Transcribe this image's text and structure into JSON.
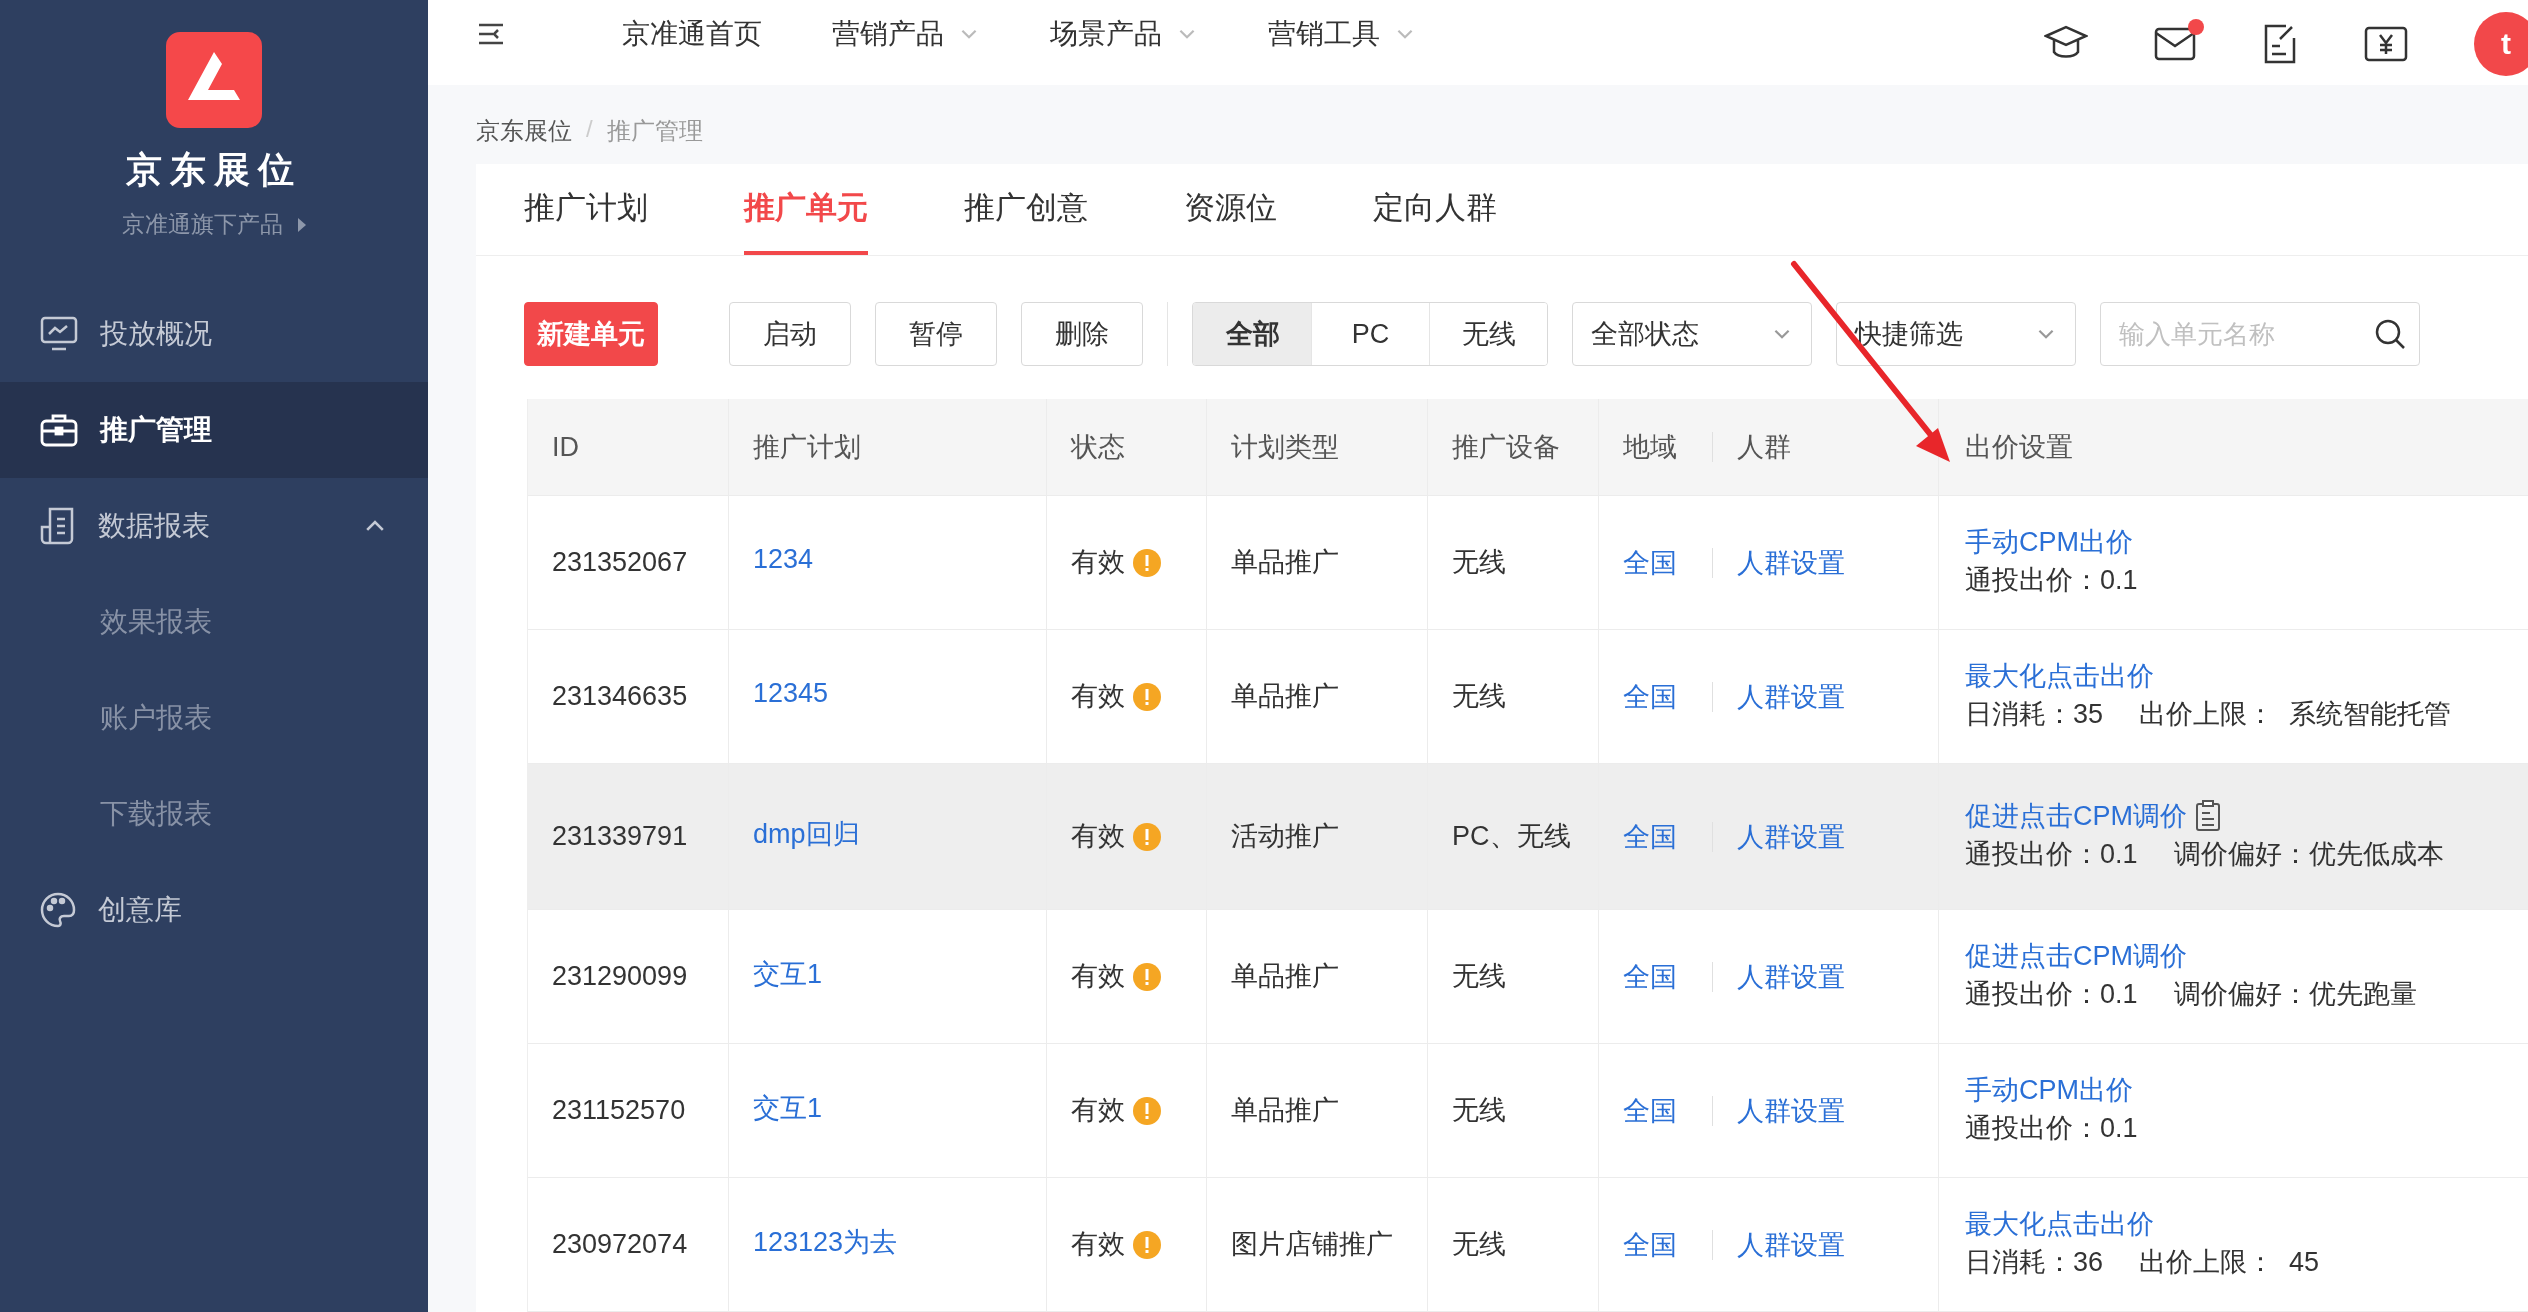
{
  "sidebar": {
    "brand": "京东展位",
    "subtitle": "京准通旗下产品",
    "items": [
      {
        "label": "投放概况",
        "selected": false
      },
      {
        "label": "推广管理",
        "selected": true
      },
      {
        "label": "数据报表",
        "selected": false,
        "expanded": true,
        "children": [
          {
            "label": "效果报表",
            "selected": false
          },
          {
            "label": "账户报表",
            "selected": false
          },
          {
            "label": "下载报表",
            "selected": false
          }
        ]
      },
      {
        "label": "创意库",
        "selected": false
      }
    ]
  },
  "top_nav": {
    "items": [
      {
        "label": "京准通首页",
        "dropdown": false
      },
      {
        "label": "营销产品",
        "dropdown": true
      },
      {
        "label": "场景产品",
        "dropdown": true
      },
      {
        "label": "营销工具",
        "dropdown": true
      }
    ],
    "mail_unread": true,
    "avatar": "t"
  },
  "breadcrumb": [
    "京东展位",
    "推广管理"
  ],
  "breadcrumb_separator": "/",
  "tabs": [
    {
      "label": "推广计划",
      "selected": false
    },
    {
      "label": "推广单元",
      "selected": true
    },
    {
      "label": "推广创意",
      "selected": false
    },
    {
      "label": "资源位",
      "selected": false
    },
    {
      "label": "定向人群",
      "selected": false
    }
  ],
  "toolbar": {
    "buttons": [
      {
        "label": "新建单元",
        "primary": true
      },
      {
        "label": "启动",
        "primary": false
      },
      {
        "label": "暂停",
        "primary": false
      },
      {
        "label": "删除",
        "primary": false
      }
    ],
    "segments": [
      {
        "label": "全部",
        "selected": true
      },
      {
        "label": "PC",
        "selected": false
      },
      {
        "label": "无线",
        "selected": false
      }
    ],
    "selects": [
      "全部状态",
      "快捷筛选"
    ],
    "search": {
      "placeholder": "输入单元名称"
    }
  },
  "table": {
    "columns": [
      "ID",
      "推广计划",
      "状态",
      "计划类型",
      "推广设备",
      "地域",
      "人群",
      "出价设置"
    ],
    "rows": [
      {
        "id": "231352067",
        "plan": "1234",
        "status": "有效",
        "warning": true,
        "plan_type": "单品推广",
        "device": "无线",
        "region": "全国",
        "crowd": "人群设置",
        "bid_title": "手动CPM出价",
        "bid_note_icon": false,
        "bid_details": [
          "通投出价：0.1"
        ],
        "highlighted": false
      },
      {
        "id": "231346635",
        "plan": "12345",
        "status": "有效",
        "warning": true,
        "plan_type": "单品推广",
        "device": "无线",
        "region": "全国",
        "crowd": "人群设置",
        "bid_title": "最大化点击出价",
        "bid_note_icon": false,
        "bid_details": [
          "日消耗：35",
          "出价上限：  系统智能托管"
        ],
        "highlighted": false
      },
      {
        "id": "231339791",
        "plan": "dmp回归",
        "status": "有效",
        "warning": true,
        "plan_type": "活动推广",
        "device": "PC、无线",
        "region": "全国",
        "crowd": "人群设置",
        "bid_title": "促进点击CPM调价",
        "bid_note_icon": true,
        "bid_details": [
          "通投出价：0.1",
          "调价偏好：优先低成本"
        ],
        "highlighted": true
      },
      {
        "id": "231290099",
        "plan": "交互1",
        "status": "有效",
        "warning": true,
        "plan_type": "单品推广",
        "device": "无线",
        "region": "全国",
        "crowd": "人群设置",
        "bid_title": "促进点击CPM调价",
        "bid_note_icon": false,
        "bid_details": [
          "通投出价：0.1",
          "调价偏好：优先跑量"
        ],
        "highlighted": false
      },
      {
        "id": "231152570",
        "plan": "交互1",
        "status": "有效",
        "warning": true,
        "plan_type": "单品推广",
        "device": "无线",
        "region": "全国",
        "crowd": "人群设置",
        "bid_title": "手动CPM出价",
        "bid_note_icon": false,
        "bid_details": [
          "通投出价：0.1"
        ],
        "highlighted": false
      },
      {
        "id": "230972074",
        "plan": "123123为去",
        "status": "有效",
        "warning": true,
        "plan_type": "图片店铺推广",
        "device": "无线",
        "region": "全国",
        "crowd": "人群设置",
        "bid_title": "最大化点击出价",
        "bid_note_icon": false,
        "bid_details": [
          "日消耗：36",
          "出价上限：  45"
        ],
        "highlighted": false
      }
    ]
  }
}
